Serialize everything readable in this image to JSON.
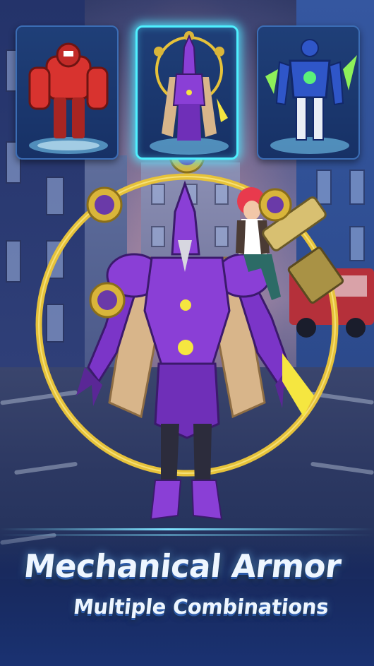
{
  "banner": {
    "headline": "Mechanical Armor",
    "subline": "Multiple Combinations"
  },
  "robots": [
    {
      "name": "red-robot",
      "color": "#d8332f",
      "selected": false
    },
    {
      "name": "purple-robot",
      "color": "#8a3fd6",
      "selected": true
    },
    {
      "name": "blue-robot",
      "color": "#2f56c8",
      "selected": false
    }
  ],
  "colors": {
    "select_glow": "#4ff0ff",
    "purple_armor": "#8a3fd6",
    "gold_ring": "#e6c23a"
  },
  "icons": {
    "ring_emblem": "tomoe-emblem-icon"
  }
}
